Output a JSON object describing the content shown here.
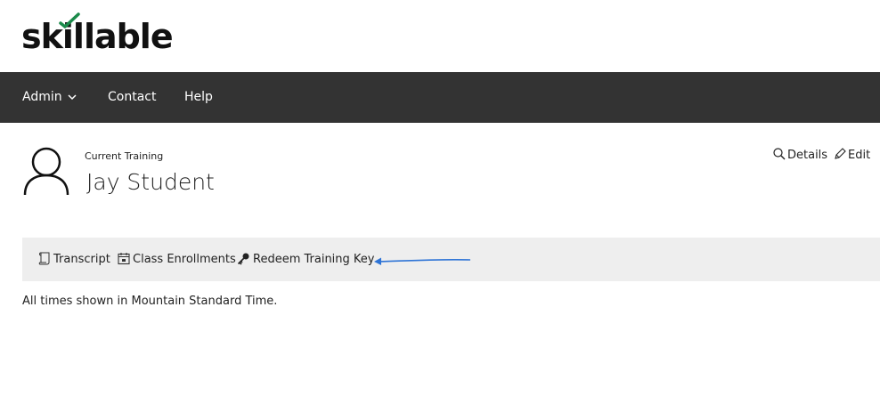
{
  "brand": {
    "logo_text": "skillable",
    "check_color": "#1a8a4a"
  },
  "nav": {
    "items": [
      {
        "label": "Admin",
        "has_dropdown": true
      },
      {
        "label": "Contact"
      },
      {
        "label": "Help"
      }
    ],
    "background": "#333333"
  },
  "profile": {
    "context_label": "Current Training",
    "name": "Jay Student",
    "actions": [
      {
        "label": "Details",
        "icon": "magnifier-icon"
      },
      {
        "label": "Edit",
        "icon": "pencil-icon"
      }
    ]
  },
  "subnav": {
    "items": [
      {
        "label": "Transcript",
        "icon": "scroll-icon"
      },
      {
        "label": "Class Enrollments",
        "icon": "calendar-icon"
      },
      {
        "label": "Redeem Training Key",
        "icon": "key-icon"
      }
    ],
    "annotation_arrow_color": "#2e74d6"
  },
  "timezone_note": "All times shown in Mountain Standard Time."
}
